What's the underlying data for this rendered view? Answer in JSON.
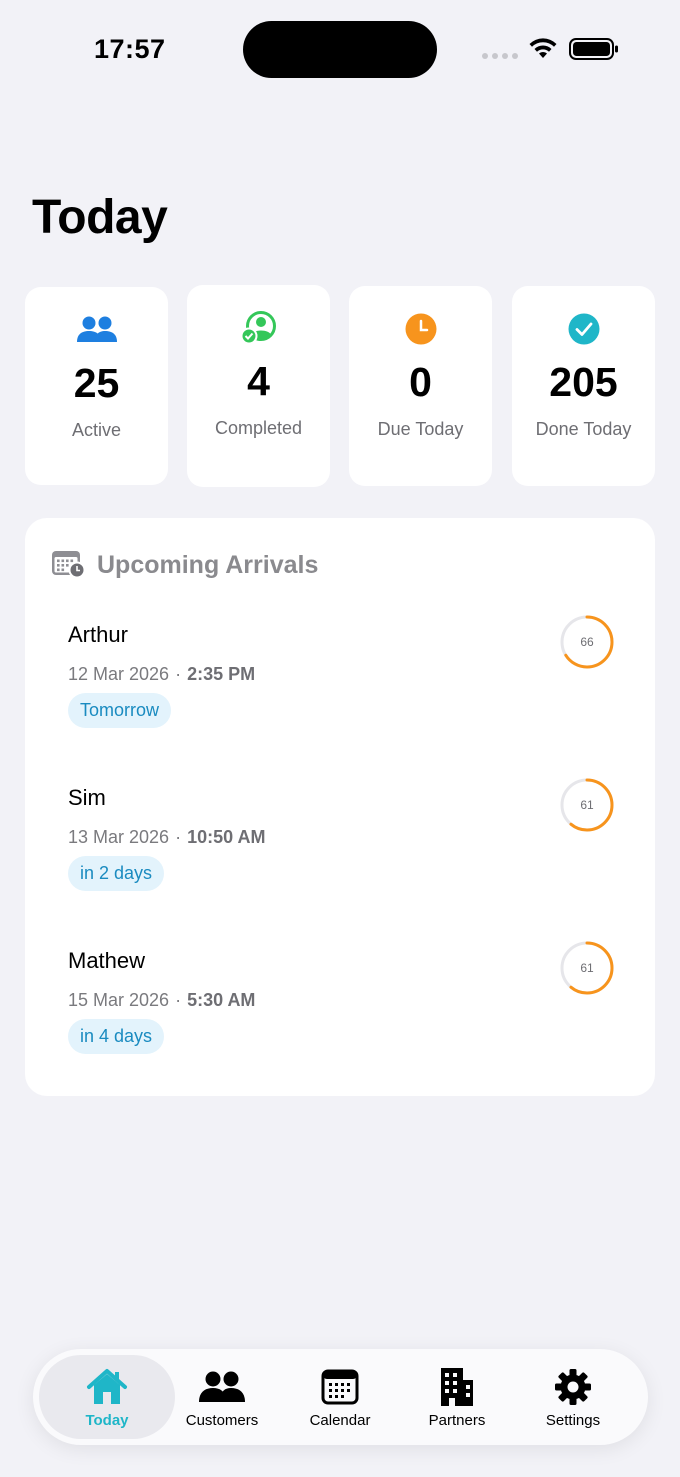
{
  "status_bar": {
    "time": "17:57"
  },
  "page": {
    "title": "Today"
  },
  "stats": [
    {
      "icon": "people-icon",
      "value": "25",
      "label": "Active",
      "color": "#1e7fe0"
    },
    {
      "icon": "person-check-icon",
      "value": "4",
      "label": "Completed",
      "color": "#34c759"
    },
    {
      "icon": "clock-icon",
      "value": "0",
      "label": "Due Today",
      "color": "#f7941d"
    },
    {
      "icon": "checkmark-circle-icon",
      "value": "205",
      "label": "Done Today",
      "color": "#1fb6c8"
    }
  ],
  "arrivals": {
    "title": "Upcoming Arrivals",
    "icon": "calendar-clock-icon",
    "items": [
      {
        "name": "Arthur",
        "date": "12 Mar 2026",
        "separator": "·",
        "time": "2:35 PM",
        "badge": "Tomorrow",
        "score": "66",
        "score_fraction": 0.66
      },
      {
        "name": "Sim",
        "date": "13 Mar 2026",
        "separator": "·",
        "time": "10:50 AM",
        "badge": "in 2 days",
        "score": "61",
        "score_fraction": 0.61
      },
      {
        "name": "Mathew",
        "date": "15 Mar 2026",
        "separator": "·",
        "time": "5:30 AM",
        "badge": "in 4 days",
        "score": "61",
        "score_fraction": 0.61
      }
    ]
  },
  "tabbar": {
    "accent": "#1fb6c8",
    "tabs": [
      {
        "label": "Today",
        "icon": "house-icon",
        "active": true
      },
      {
        "label": "Customers",
        "icon": "people-icon",
        "active": false
      },
      {
        "label": "Calendar",
        "icon": "calendar-icon",
        "active": false
      },
      {
        "label": "Partners",
        "icon": "building-icon",
        "active": false
      },
      {
        "label": "Settings",
        "icon": "gear-icon",
        "active": false
      }
    ]
  }
}
